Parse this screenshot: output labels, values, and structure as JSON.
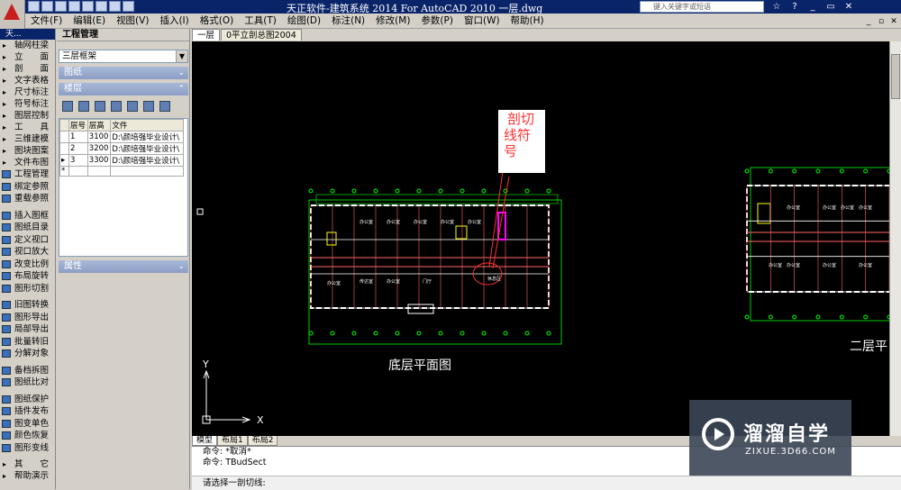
{
  "title": "天正软件-建筑系统 2014  For AutoCAD 2010  一层.dwg",
  "search_placeholder": "键入关键字或短语",
  "menu": [
    "文件(F)",
    "编辑(E)",
    "视图(V)",
    "插入(I)",
    "格式(O)",
    "工具(T)",
    "绘图(D)",
    "标注(N)",
    "修改(M)",
    "参数(P)",
    "窗口(W)",
    "帮助(H)"
  ],
  "sidebar": {
    "header": "天...",
    "items": [
      "轴网柱梁",
      "立　　面",
      "剖　　面",
      "文字表格",
      "尺寸标注",
      "符号标注",
      "图层控制",
      "工　　具",
      "三维建模",
      "图块图案",
      "文件布图"
    ],
    "commands": [
      "工程管理",
      "绑定参照",
      "重载参照",
      "插入图框",
      "图纸目录",
      "定义视口",
      "视口放大",
      "改变比例",
      "布局旋转",
      "图形切割",
      "旧图转换",
      "图形导出",
      "局部导出",
      "批量转旧",
      "分解对象",
      "备档拆图",
      "图纸比对",
      "图纸保护",
      "插件发布",
      "图变单色",
      "颜色恢复",
      "图形变线"
    ],
    "bottom": [
      "其　　它",
      "帮助演示"
    ]
  },
  "panel": {
    "title": "工程管理",
    "project": "三层框架",
    "section_drawings": "图纸",
    "section_floors": "楼层",
    "section_props": "属性",
    "columns": [
      "层号",
      "层高",
      "文件"
    ],
    "rows": [
      {
        "n": "1",
        "h": "3100",
        "f": "D:\\颜培强毕业设计\\"
      },
      {
        "n": "2",
        "h": "3200",
        "f": "D:\\颜培强毕业设计\\"
      },
      {
        "n": "3",
        "h": "3300",
        "f": "D:\\颜培强毕业设计\\"
      }
    ]
  },
  "doc_tabs": [
    "一层",
    "0平立剖总图2004"
  ],
  "layout_tabs": [
    "模型",
    "布局1",
    "布局2"
  ],
  "drawing": {
    "annot": [
      "剖切",
      "线符",
      "号"
    ],
    "caption1": "底层平面图",
    "caption2": "二层平",
    "rooms1": [
      "办公室",
      "办公室",
      "办公室",
      "办公室",
      "办公室",
      "办公室",
      "门厅",
      "休息区",
      "传达室",
      "办公室"
    ],
    "rooms2": [
      "办公室",
      "办公室",
      "办公室",
      "办公室",
      "办公室",
      "办公室",
      "办公室",
      "办公室"
    ]
  },
  "ucs": {
    "y": "Y",
    "x": "X"
  },
  "command_lines": [
    "命令: *取消*",
    "命令: TBudSect"
  ],
  "prompt": "请选择一剖切线:",
  "watermark": {
    "title": "溜溜自学",
    "url": "ZIXUE.3D66.COM"
  },
  "colors": {
    "plan": "#00ff00",
    "walls": "#ffffff",
    "annotation": "#ff3030",
    "stairs": "#ffff00"
  }
}
